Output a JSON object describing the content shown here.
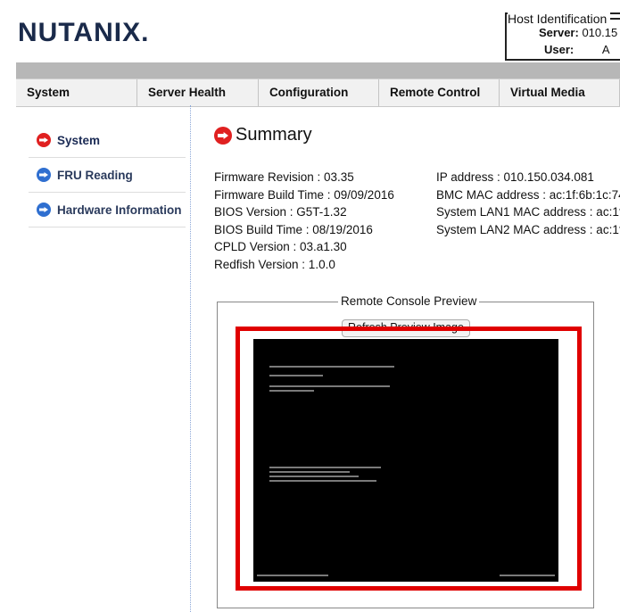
{
  "brand": {
    "logo_text": "NUTANIX."
  },
  "host": {
    "title": "Host Identification",
    "server_label": "Server:",
    "server_value": "010.15",
    "user_label": "User:",
    "user_value": "A"
  },
  "nav": {
    "items": [
      "System",
      "Server Health",
      "Configuration",
      "Remote Control",
      "Virtual Media"
    ]
  },
  "sidebar": {
    "items": [
      {
        "label": "System",
        "icon": "arrow-right-red-icon",
        "active": true
      },
      {
        "label": "FRU Reading",
        "icon": "arrow-right-blue-icon"
      },
      {
        "label": "Hardware Information",
        "icon": "arrow-right-blue-icon"
      }
    ]
  },
  "summary": {
    "title": "Summary",
    "left": [
      "Firmware Revision : 03.35",
      "Firmware Build Time : 09/09/2016",
      "BIOS Version : G5T-1.32",
      "BIOS Build Time : 08/19/2016",
      "CPLD Version : 03.a1.30",
      "Redfish Version : 1.0.0"
    ],
    "right": [
      "IP address : 010.150.034.081",
      "BMC MAC address : ac:1f:6b:1c:74",
      "System LAN1 MAC address : ac:1f:",
      "System LAN2 MAC address : ac:1f:"
    ]
  },
  "preview": {
    "legend": "Remote Console Preview",
    "refresh_label": "Refresh Preview Image"
  },
  "colors": {
    "accent_red": "#e00000",
    "nav_bg": "#f1f1f1",
    "band": "#b7b7b7"
  }
}
